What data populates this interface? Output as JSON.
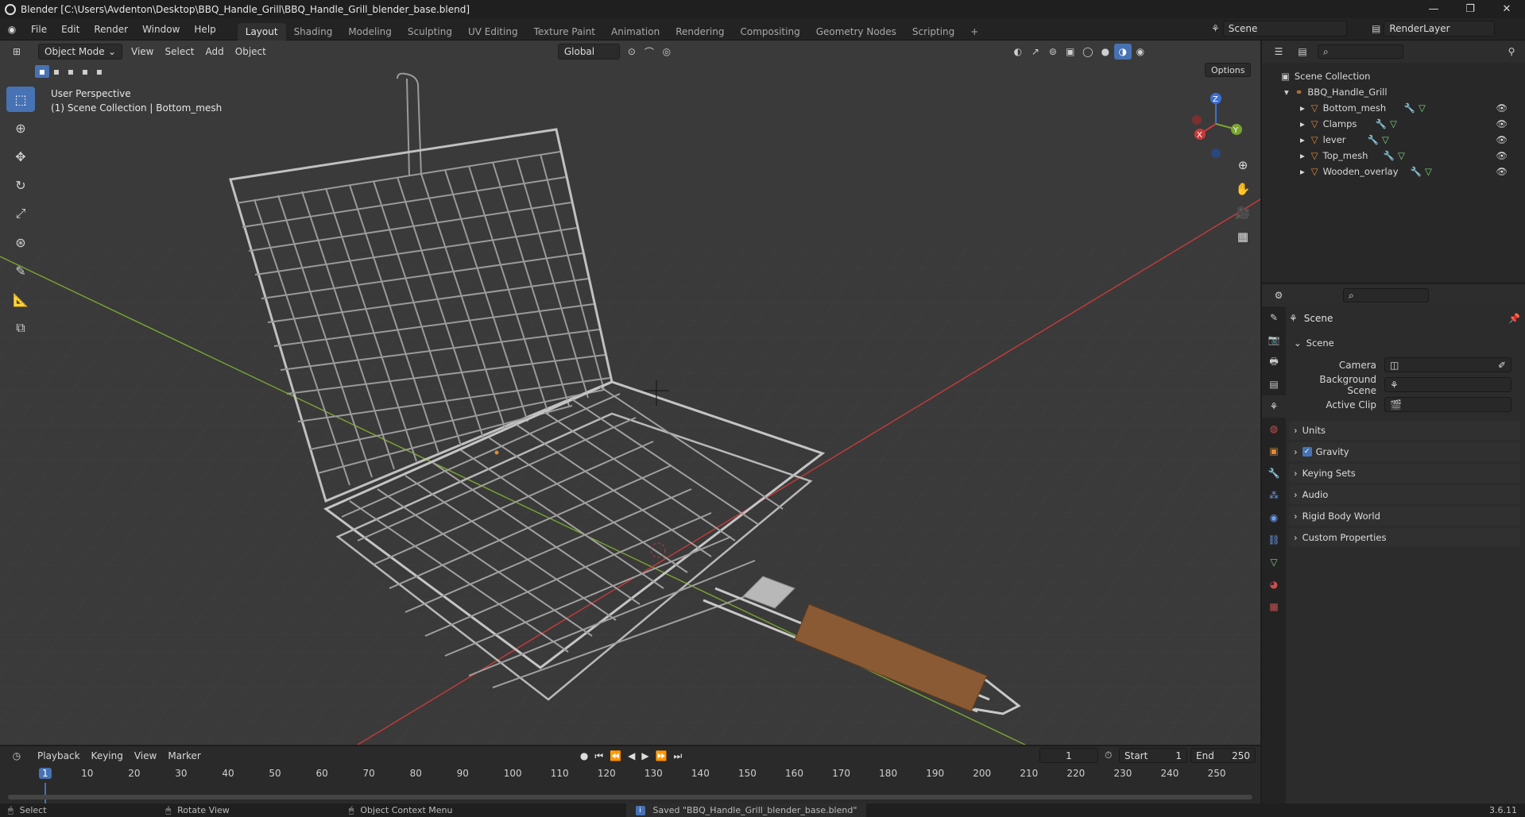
{
  "window": {
    "title": "Blender [C:\\Users\\Avdenton\\Desktop\\BBQ_Handle_Grill\\BBQ_Handle_Grill_blender_base.blend]",
    "minimize": "—",
    "maximize": "❐",
    "close": "✕"
  },
  "menu": {
    "items": [
      "File",
      "Edit",
      "Render",
      "Window",
      "Help"
    ],
    "workspaces": [
      "Layout",
      "Shading",
      "Modeling",
      "Sculpting",
      "UV Editing",
      "Texture Paint",
      "Animation",
      "Rendering",
      "Compositing",
      "Geometry Nodes",
      "Scripting"
    ],
    "add_workspace": "+",
    "scene_name": "Scene",
    "view_layer": "RenderLayer"
  },
  "viewport": {
    "mode": "Object Mode",
    "menus": [
      "View",
      "Select",
      "Add",
      "Object"
    ],
    "orientation": "Global",
    "options_label": "Options",
    "info_line1": "User Perspective",
    "info_line2": "(1) Scene Collection | Bottom_mesh",
    "gizmo": {
      "x": "X",
      "y": "Y",
      "z": "Z"
    }
  },
  "outliner": {
    "root": "Scene Collection",
    "collection": "BBQ_Handle_Grill",
    "objects": [
      "Bottom_mesh",
      "Clamps",
      "lever",
      "Top_mesh",
      "Wooden_overlay"
    ]
  },
  "properties": {
    "context": "Scene",
    "panel_title": "Scene",
    "camera_label": "Camera",
    "background_label": "Background Scene",
    "clip_label": "Active Clip",
    "sections": [
      "Units",
      "Gravity",
      "Keying Sets",
      "Audio",
      "Rigid Body World",
      "Custom Properties"
    ],
    "gravity_checked": true
  },
  "timeline": {
    "menus": [
      "Playback",
      "Keying",
      "View",
      "Marker"
    ],
    "current_frame": "1",
    "start_label": "Start",
    "start_value": "1",
    "end_label": "End",
    "end_value": "250",
    "ruler": [
      "1",
      "10",
      "20",
      "30",
      "40",
      "50",
      "60",
      "70",
      "80",
      "90",
      "100",
      "110",
      "120",
      "130",
      "140",
      "150",
      "160",
      "170",
      "180",
      "190",
      "200",
      "210",
      "220",
      "230",
      "240",
      "250"
    ]
  },
  "status": {
    "select": "Select",
    "rotate": "Rotate View",
    "context_menu": "Object Context Menu",
    "message": "Saved \"BBQ_Handle_Grill_blender_base.blend\"",
    "version": "3.6.11"
  },
  "colors": {
    "accent": "#4772b3",
    "axis_x": "#c83a3a",
    "axis_y": "#7aa531",
    "object_orange": "#e08a36",
    "wood": "#8a5a34"
  }
}
